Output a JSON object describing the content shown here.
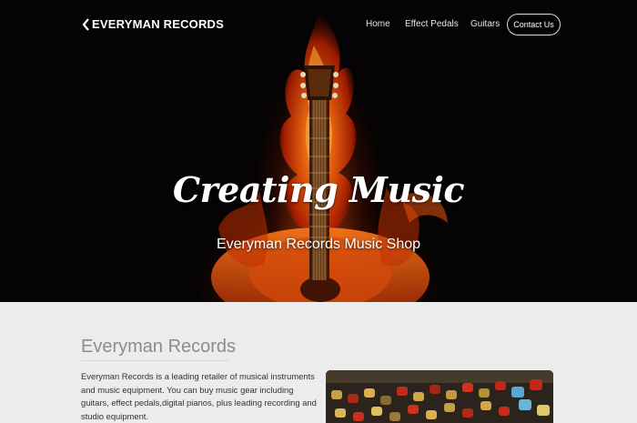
{
  "brand": {
    "name": "EVERYMAN RECORDS"
  },
  "nav": {
    "items": [
      "Home",
      "Effect Pedals",
      "Guitars"
    ],
    "contact_label": "Contact Us"
  },
  "hero": {
    "title": "Creating Music",
    "subtitle": "Everyman Records Music Shop"
  },
  "about": {
    "heading": "Everyman Records",
    "text": "Everyman Records is a leading retailer of musical instruments and music equipment. You can buy music gear including guitars, effect pedals,digital pianos, plus leading recording and studio equipment."
  },
  "colors": {
    "hero_bg": "#050303",
    "flame": "#ff5a0a",
    "page_bg": "#ececec"
  }
}
